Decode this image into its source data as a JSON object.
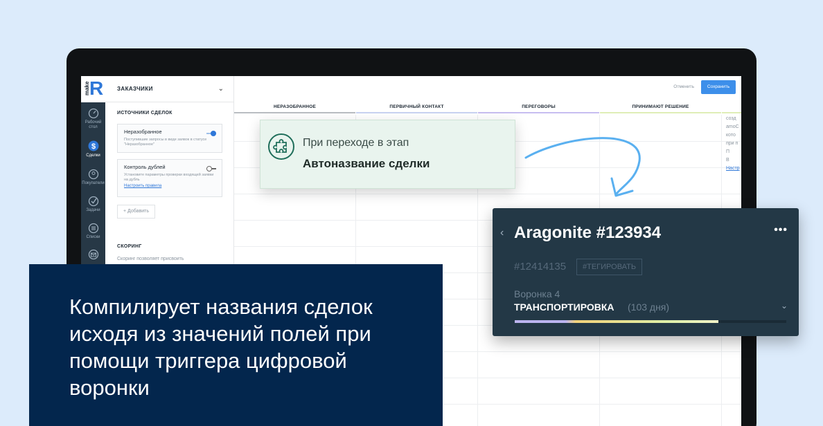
{
  "sidebar": {
    "logo_text": "make",
    "logo_letter": "R",
    "items": [
      {
        "label": "Рабочий стол",
        "icon": "dashboard-icon"
      },
      {
        "label": "Сделки",
        "icon": "deals-icon",
        "active": true
      },
      {
        "label": "Покупатели",
        "icon": "customers-icon"
      },
      {
        "label": "Задачи",
        "icon": "tasks-icon"
      },
      {
        "label": "Списки",
        "icon": "lists-icon"
      },
      {
        "label": "",
        "icon": "mail-icon"
      }
    ]
  },
  "panel": {
    "title": "ЗАКАЗЧИКИ",
    "sources_title": "ИСТОЧНИКИ СДЕЛОК",
    "cards": [
      {
        "title": "Неразобранное",
        "desc": "Поступившие запросы в виде заявок в статусе \"Неразобранное\"",
        "enabled": true,
        "link": ""
      },
      {
        "title": "Контроль дублей",
        "desc": "Установите параметры проверки входящей заявки на дубль",
        "enabled": false,
        "link": "Настроить правила"
      }
    ],
    "add_label": "+ Добавить",
    "scoring_title": "СКОРИНГ",
    "scoring_desc": "Скоринг позволяет присвоить"
  },
  "toolbar": {
    "cancel_label": "Отменить",
    "save_label": "Сохранить"
  },
  "pipeline": {
    "stages": [
      {
        "name": "НЕРАЗОБРАННОЕ",
        "color": "#b9bdc2"
      },
      {
        "name": "ПЕРВИЧНЫЙ КОНТАКТ",
        "color": "#c9d3f2"
      },
      {
        "name": "ПЕРЕГОВОРЫ",
        "color": "#c7bdf0"
      },
      {
        "name": "ПРИНИМАЮТ РЕШЕНИЕ",
        "color": "#dfeeb6"
      }
    ],
    "right_fragment": [
      "созд",
      "amoC",
      "кото",
      "при п",
      "П",
      "В",
      "Настр"
    ]
  },
  "trigger": {
    "line1": "При переходе в этап",
    "line2": "Автоназвание сделки"
  },
  "deal": {
    "name": "Aragonite #123934",
    "id": "#12414135",
    "tag_label": "#ТЕГИРОВАТЬ",
    "funnel": "Воронка 4",
    "stage": "ТРАНСПОРТИРОВКА",
    "days": "(103 дня)",
    "progress": 0.75
  },
  "caption": {
    "text": "Компилирует названия сделок исходя из значений полей при помощи триггера цифровой воронки"
  },
  "colors": {
    "background": "#dcebfb",
    "accent": "#2e77d8",
    "navy": "#03264d",
    "deal_card": "#233846",
    "trigger_bg": "#e9f4ee"
  }
}
